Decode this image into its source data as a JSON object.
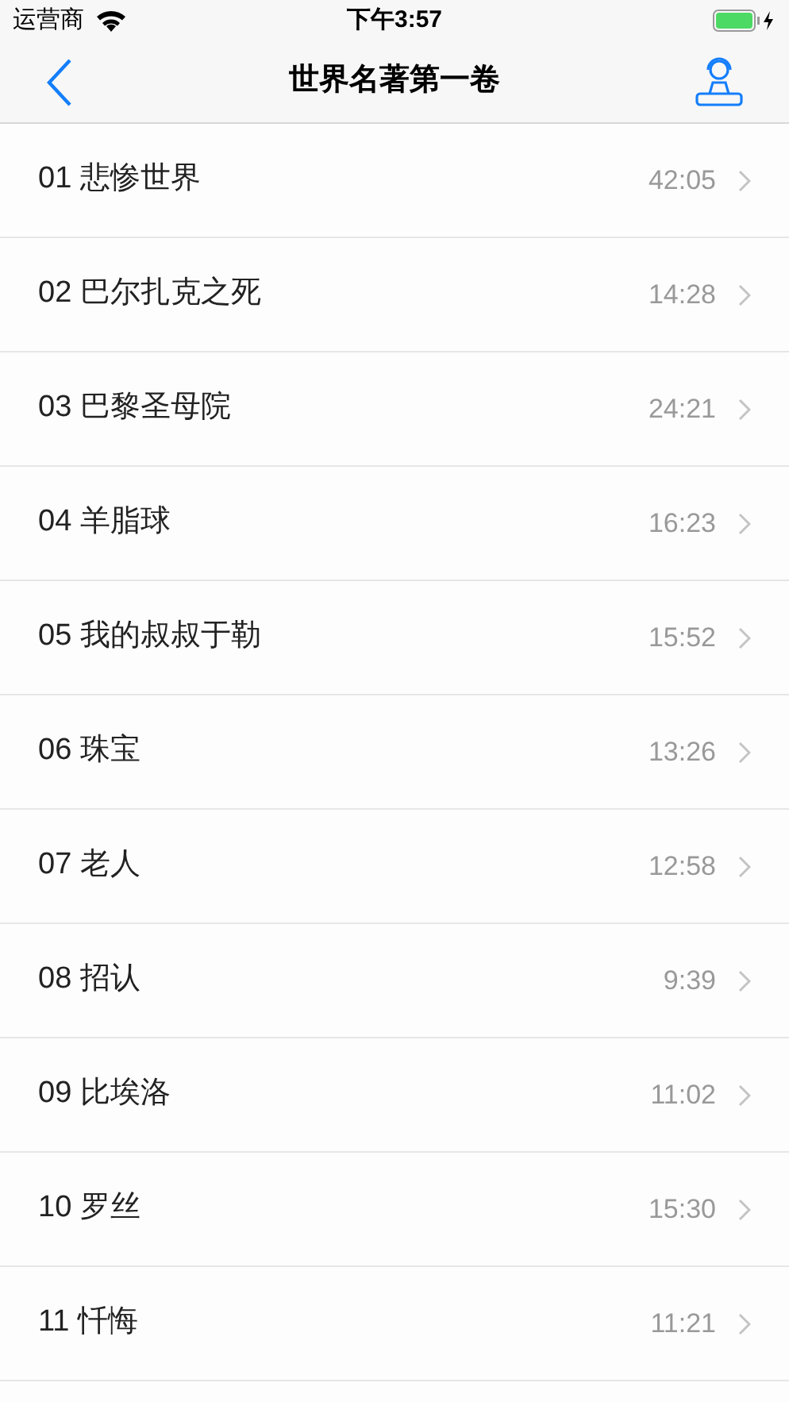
{
  "status_bar": {
    "carrier": "运营商",
    "time": "下午3:57"
  },
  "nav": {
    "title": "世界名著第一卷"
  },
  "tracks": [
    {
      "title": "01 悲惨世界",
      "duration": "42:05"
    },
    {
      "title": "02 巴尔扎克之死",
      "duration": "14:28"
    },
    {
      "title": "03 巴黎圣母院",
      "duration": "24:21"
    },
    {
      "title": "04 羊脂球",
      "duration": "16:23"
    },
    {
      "title": "05 我的叔叔于勒",
      "duration": "15:52"
    },
    {
      "title": "06 珠宝",
      "duration": "13:26"
    },
    {
      "title": "07 老人",
      "duration": "12:58"
    },
    {
      "title": "08 招认",
      "duration": "9:39"
    },
    {
      "title": "09 比埃洛",
      "duration": "11:02"
    },
    {
      "title": "10 罗丝",
      "duration": "15:30"
    },
    {
      "title": "11 忏悔",
      "duration": "11:21"
    }
  ]
}
